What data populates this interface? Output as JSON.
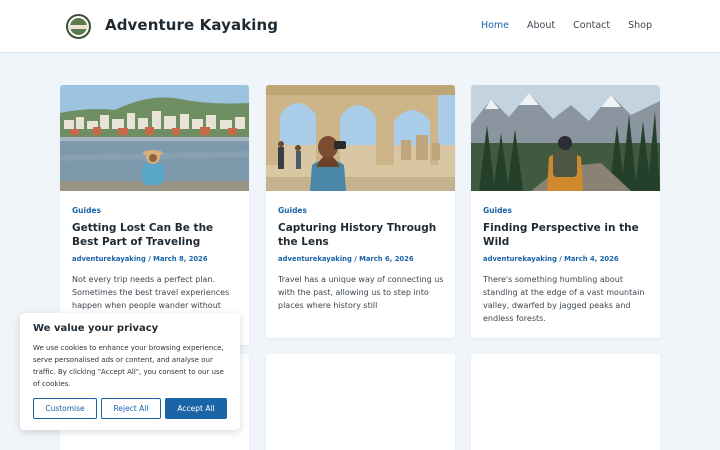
{
  "site": {
    "title": "Adventure Kayaking"
  },
  "nav": [
    {
      "label": "Home",
      "active": true
    },
    {
      "label": "About",
      "active": false
    },
    {
      "label": "Contact",
      "active": false
    },
    {
      "label": "Shop",
      "active": false
    }
  ],
  "posts": [
    {
      "category": "Guides",
      "title": "Getting Lost Can Be the Best Part of Traveling",
      "author": "adventurekayaking",
      "date": "March 8, 2026",
      "excerpt": "Not every trip needs a perfect plan. Sometimes the best travel experiences happen when people wander without",
      "image": "woman-by-lake-town-photo"
    },
    {
      "category": "Guides",
      "title": "Capturing History Through the Lens",
      "author": "adventurekayaking",
      "date": "March 6, 2026",
      "excerpt": "Travel has a unique way of connecting us with the past, allowing us to step into places where history still",
      "image": "woman-photographing-ruins-photo"
    },
    {
      "category": "Guides",
      "title": "Finding Perspective in the Wild",
      "author": "adventurekayaking",
      "date": "March 4, 2026",
      "excerpt": "There's something humbling about standing at the edge of a vast mountain valley, dwarfed by jagged peaks and endless forests.",
      "image": "hiker-mountain-valley-photo"
    }
  ],
  "cookie": {
    "title": "We value your privacy",
    "text": "We use cookies to enhance your browsing experience, serve personalised ads or content, and analyse our traffic. By clicking \"Accept All\", you consent to our use of cookies.",
    "customise": "Customise",
    "reject": "Reject All",
    "accept": "Accept All"
  }
}
